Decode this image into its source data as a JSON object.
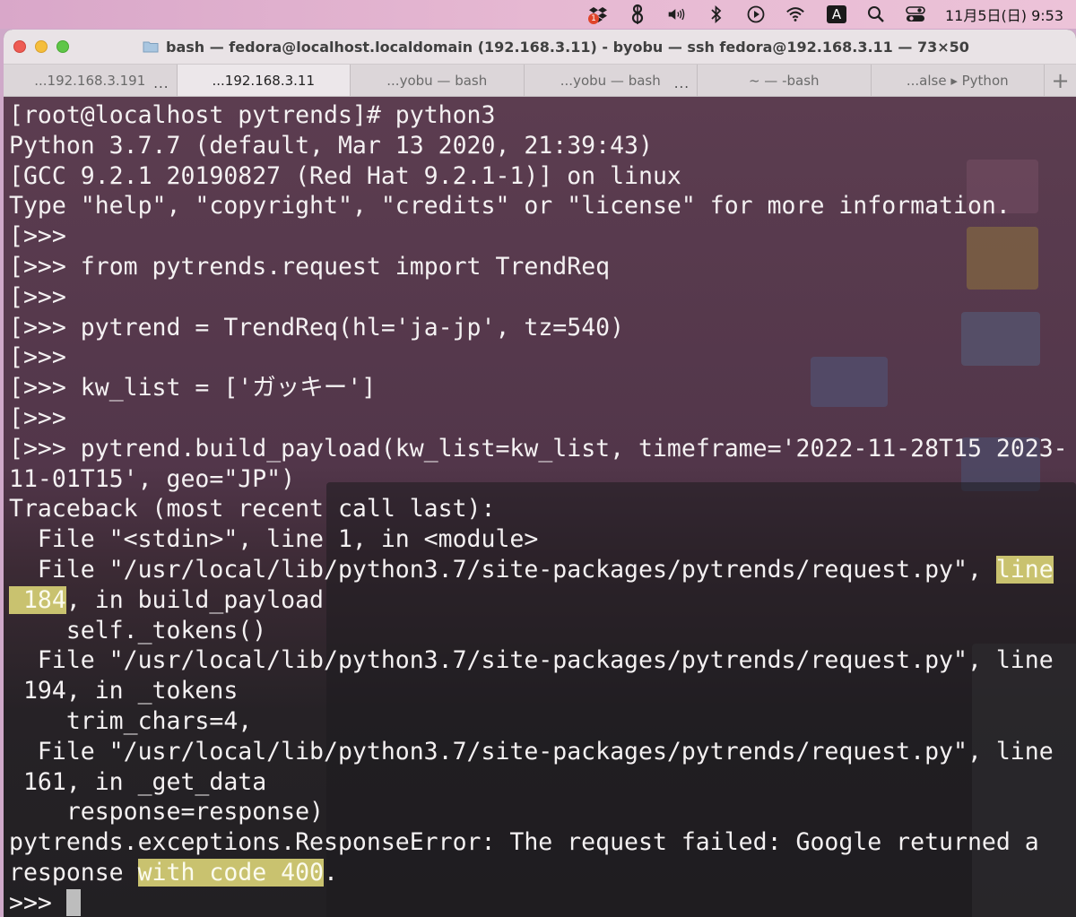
{
  "menubar": {
    "dropbox_badge": "1",
    "input_method": "A",
    "datetime": "11月5日(日) 9:53",
    "icons": [
      "dropbox-icon",
      "script-icon",
      "volume-icon",
      "bluetooth-icon",
      "play-icon",
      "wifi-icon",
      "input-source-icon",
      "spotlight-icon",
      "control-center-icon"
    ]
  },
  "window": {
    "title": "bash — fedora@localhost.localdomain (192.168.3.11) - byobu — ssh fedora@192.168.3.11 — 73×50",
    "tabs": [
      {
        "label": "...192.168.3.191",
        "active": false,
        "dots": "..."
      },
      {
        "label": "...192.168.3.11",
        "active": true,
        "dots": ""
      },
      {
        "label": "...yobu — bash",
        "active": false,
        "dots": ""
      },
      {
        "label": "...yobu — bash",
        "active": false,
        "dots": "..."
      },
      {
        "label": "~ — -bash",
        "active": false,
        "dots": ""
      },
      {
        "label": "...alse ▸ Python",
        "active": false,
        "dots": ""
      }
    ],
    "new_tab": "+"
  },
  "terminal": {
    "lines": [
      [
        {
          "t": "["
        },
        {
          "t": "root@localhost pytrends]# python3"
        }
      ],
      [
        {
          "t": "Python 3.7.7 (default, Mar 13 2020, 21:39:43)"
        }
      ],
      [
        {
          "t": "[GCC 9.2.1 20190827 (Red Hat 9.2.1-1)] on linux"
        }
      ],
      [
        {
          "t": "Type \"help\", \"copyright\", \"credits\" or \"license\" for more information."
        }
      ],
      [
        {
          "t": "["
        },
        {
          "t": ">>>"
        }
      ],
      [
        {
          "t": "["
        },
        {
          "t": ">>> from pytrends.request import TrendReq"
        }
      ],
      [
        {
          "t": "["
        },
        {
          "t": ">>>"
        }
      ],
      [
        {
          "t": "["
        },
        {
          "t": ">>> pytrend = TrendReq(hl='ja-jp', tz=540)"
        }
      ],
      [
        {
          "t": "["
        },
        {
          "t": ">>>"
        }
      ],
      [
        {
          "t": "["
        },
        {
          "t": ">>> kw_list = ['ガッキー']"
        }
      ],
      [
        {
          "t": "["
        },
        {
          "t": ">>>"
        }
      ],
      [
        {
          "t": "["
        },
        {
          "t": ">>> pytrend.build_payload(kw_list=kw_list, timeframe='2022-11-28T15 2023-"
        }
      ],
      [
        {
          "t": "11-01T15', geo=\"JP\")"
        }
      ],
      [
        {
          "t": "Traceback (most recent call last):"
        }
      ],
      [
        {
          "t": "  File \"<stdin>\", line 1, in <module>"
        }
      ],
      [
        {
          "t": "  File \"/usr/local/lib/python3.7/site-packages/pytrends/request.py\", "
        },
        {
          "t": "line",
          "hl": true
        }
      ],
      [
        {
          "t": " 184",
          "hl": true
        },
        {
          "t": ", in build_payload"
        }
      ],
      [
        {
          "t": "    self._tokens()"
        }
      ],
      [
        {
          "t": "  File \"/usr/local/lib/python3.7/site-packages/pytrends/request.py\", line"
        }
      ],
      [
        {
          "t": " 194, in _tokens"
        }
      ],
      [
        {
          "t": "    trim_chars=4,"
        }
      ],
      [
        {
          "t": "  File \"/usr/local/lib/python3.7/site-packages/pytrends/request.py\", line"
        }
      ],
      [
        {
          "t": " 161, in _get_data"
        }
      ],
      [
        {
          "t": "    response=response)"
        }
      ],
      [
        {
          "t": "pytrends.exceptions.ResponseError: The request failed: Google returned a"
        }
      ],
      [
        {
          "t": "response "
        },
        {
          "t": "with code 400",
          "hl": true
        },
        {
          "t": "."
        }
      ],
      [
        {
          "t": ">>> "
        },
        {
          "cursor": true
        }
      ]
    ]
  }
}
